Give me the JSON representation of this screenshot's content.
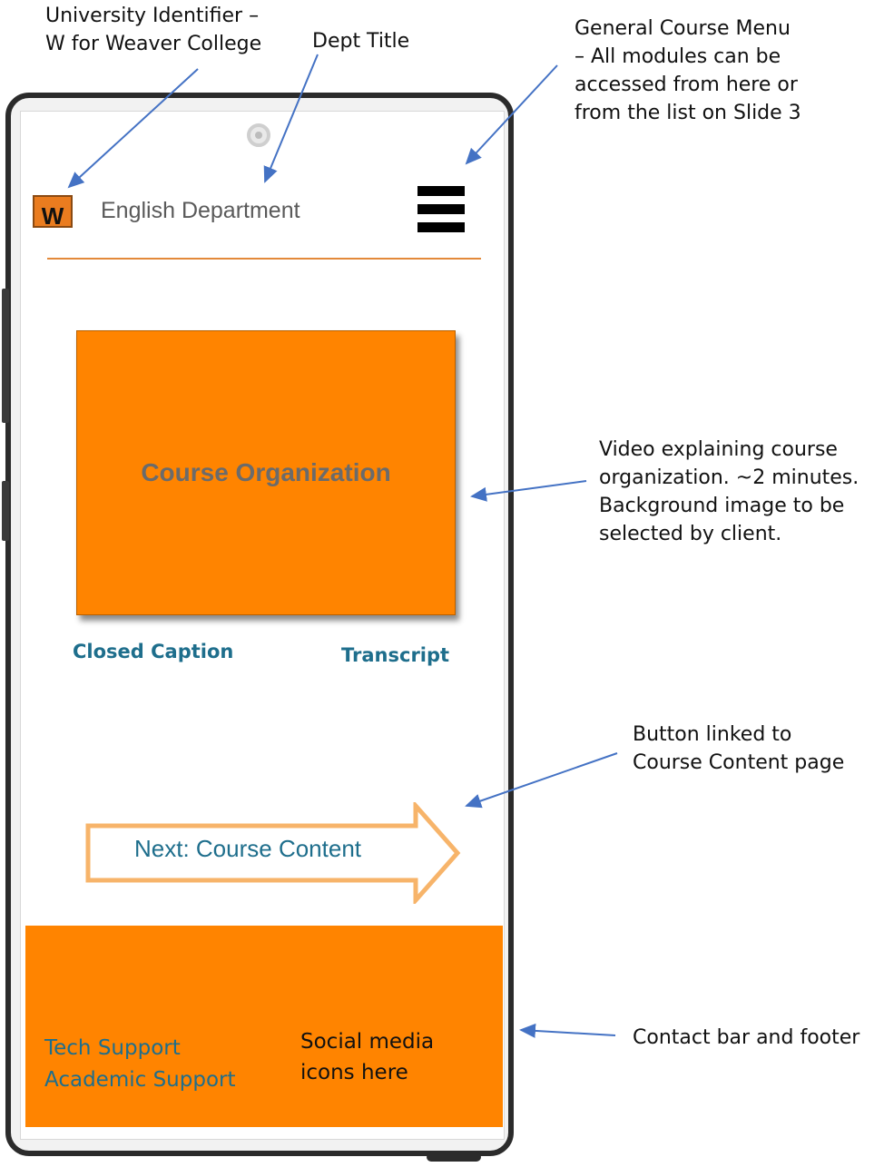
{
  "app": {
    "logo_letter": "W",
    "dept_title": "English Department",
    "menu_icon": "hamburger-menu-icon"
  },
  "video": {
    "title": "Course Organization",
    "closed_caption_label": "Closed Caption",
    "transcript_label": "Transcript"
  },
  "next_button": {
    "label": "Next: Course Content"
  },
  "footer": {
    "tech_support": "Tech Support",
    "academic_support": "Academic Support",
    "social_line1": "Social media",
    "social_line2": "icons here"
  },
  "annotations": {
    "university_id": "University  Identifier –\nW for Weaver College",
    "dept_title": "Dept Title",
    "course_menu": "General Course Menu\n– All modules can be\naccessed from here or\nfrom the list on Slide 3",
    "video": "Video explaining course\norganization. ~2 minutes.\nBackground image to be\nselected by client.",
    "button": "Button linked to\nCourse Content page",
    "footer": "Contact bar and footer"
  },
  "colors": {
    "orange": "#ff8400",
    "link_blue": "#1e6e8c",
    "arrow_blue": "#4472c4",
    "button_outline": "#f7b46a"
  }
}
